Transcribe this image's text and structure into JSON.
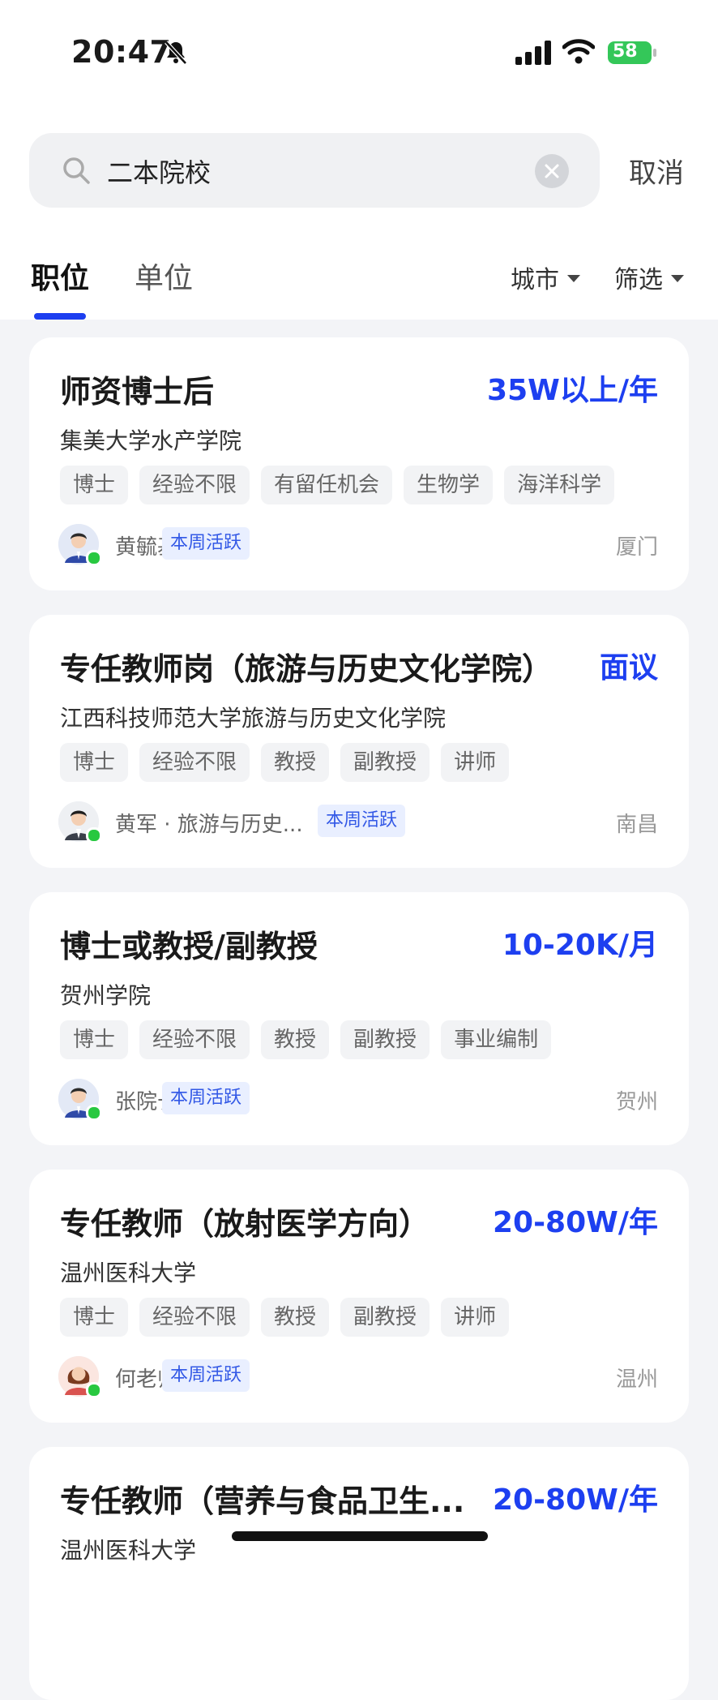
{
  "status_bar": {
    "time": "20:47",
    "battery": "58"
  },
  "search": {
    "query": "二本院校",
    "cancel_label": "取消"
  },
  "tabs": [
    {
      "label": "职位",
      "active": true
    },
    {
      "label": "单位",
      "active": false
    }
  ],
  "filters": {
    "city_label": "城市",
    "filter_label": "筛选"
  },
  "colors": {
    "accent": "#1d3ff0",
    "badge_bg": "#e9efff",
    "online": "#28c840"
  },
  "jobs": [
    {
      "title": "师资博士后",
      "salary": "35W以上/年",
      "org": "集美大学水产学院",
      "tags": [
        "博士",
        "经验不限",
        "有留任机会",
        "生物学",
        "海洋科学"
      ],
      "recruiter": "黄毓基",
      "badge": "本周活跃",
      "city": "厦门",
      "avatar": "male-avatar-icon"
    },
    {
      "title": "专任教师岗（旅游与历史文化学院）",
      "salary": "面议",
      "org": "江西科技师范大学旅游与历史文化学院",
      "tags": [
        "博士",
        "经验不限",
        "教授",
        "副教授",
        "讲师"
      ],
      "recruiter": "黄军 · 旅游与历史...",
      "badge": "本周活跃",
      "city": "南昌",
      "avatar": "male-suit-avatar-icon"
    },
    {
      "title": "博士或教授/副教授",
      "salary": "10-20K/月",
      "org": "贺州学院",
      "tags": [
        "博士",
        "经验不限",
        "教授",
        "副教授",
        "事业编制"
      ],
      "recruiter": "张院长",
      "badge": "本周活跃",
      "city": "贺州",
      "avatar": "male-avatar-icon"
    },
    {
      "title": "专任教师（放射医学方向）",
      "salary": "20-80W/年",
      "org": "温州医科大学",
      "tags": [
        "博士",
        "经验不限",
        "教授",
        "副教授",
        "讲师"
      ],
      "recruiter": "何老师",
      "badge": "本周活跃",
      "city": "温州",
      "avatar": "female-avatar-icon"
    },
    {
      "title": "专任教师（营养与食品卫生...",
      "salary": "20-80W/年",
      "org": "温州医科大学",
      "tags": [],
      "recruiter": "",
      "badge": "",
      "city": ""
    }
  ]
}
